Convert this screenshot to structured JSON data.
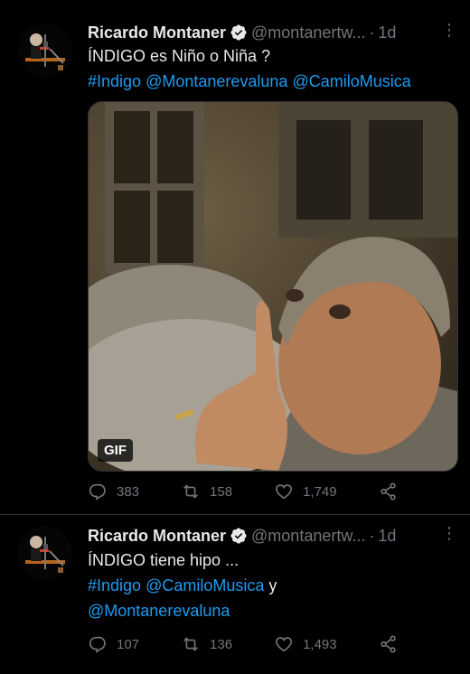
{
  "tweets": [
    {
      "author": {
        "name": "Ricardo Montaner",
        "handle": "@montanertw...",
        "time": "1d"
      },
      "more_label": "⋮",
      "text_line1": "ÍNDIGO es Niño o Niña ?",
      "line2": {
        "hashtag": "#Indigo",
        "mention1": "@Montanerevaluna",
        "mention2": "@CamiloMusica"
      },
      "media": {
        "badge": "GIF"
      },
      "stats": {
        "replies": "383",
        "retweets": "158",
        "likes": "1,749"
      }
    },
    {
      "author": {
        "name": "Ricardo Montaner",
        "handle": "@montanertw...",
        "time": "1d"
      },
      "more_label": "⋮",
      "text_line1": "ÍNDIGO tiene hipo ...",
      "line2": {
        "hashtag": "#Indigo",
        "mention1": "@CamiloMusica",
        "joiner": "y"
      },
      "line3": {
        "mention": "@Montanerevaluna"
      },
      "stats": {
        "replies": "107",
        "retweets": "136",
        "likes": "1,493"
      }
    }
  ],
  "colors": {
    "background": "#000000",
    "text": "#e7e9ea",
    "secondary": "#71767b",
    "link": "#1d9bf0",
    "divider": "#2f3336"
  },
  "icons": {
    "verified": "verified-badge-icon",
    "reply": "reply-icon",
    "retweet": "retweet-icon",
    "like": "heart-icon",
    "share": "share-icon"
  }
}
